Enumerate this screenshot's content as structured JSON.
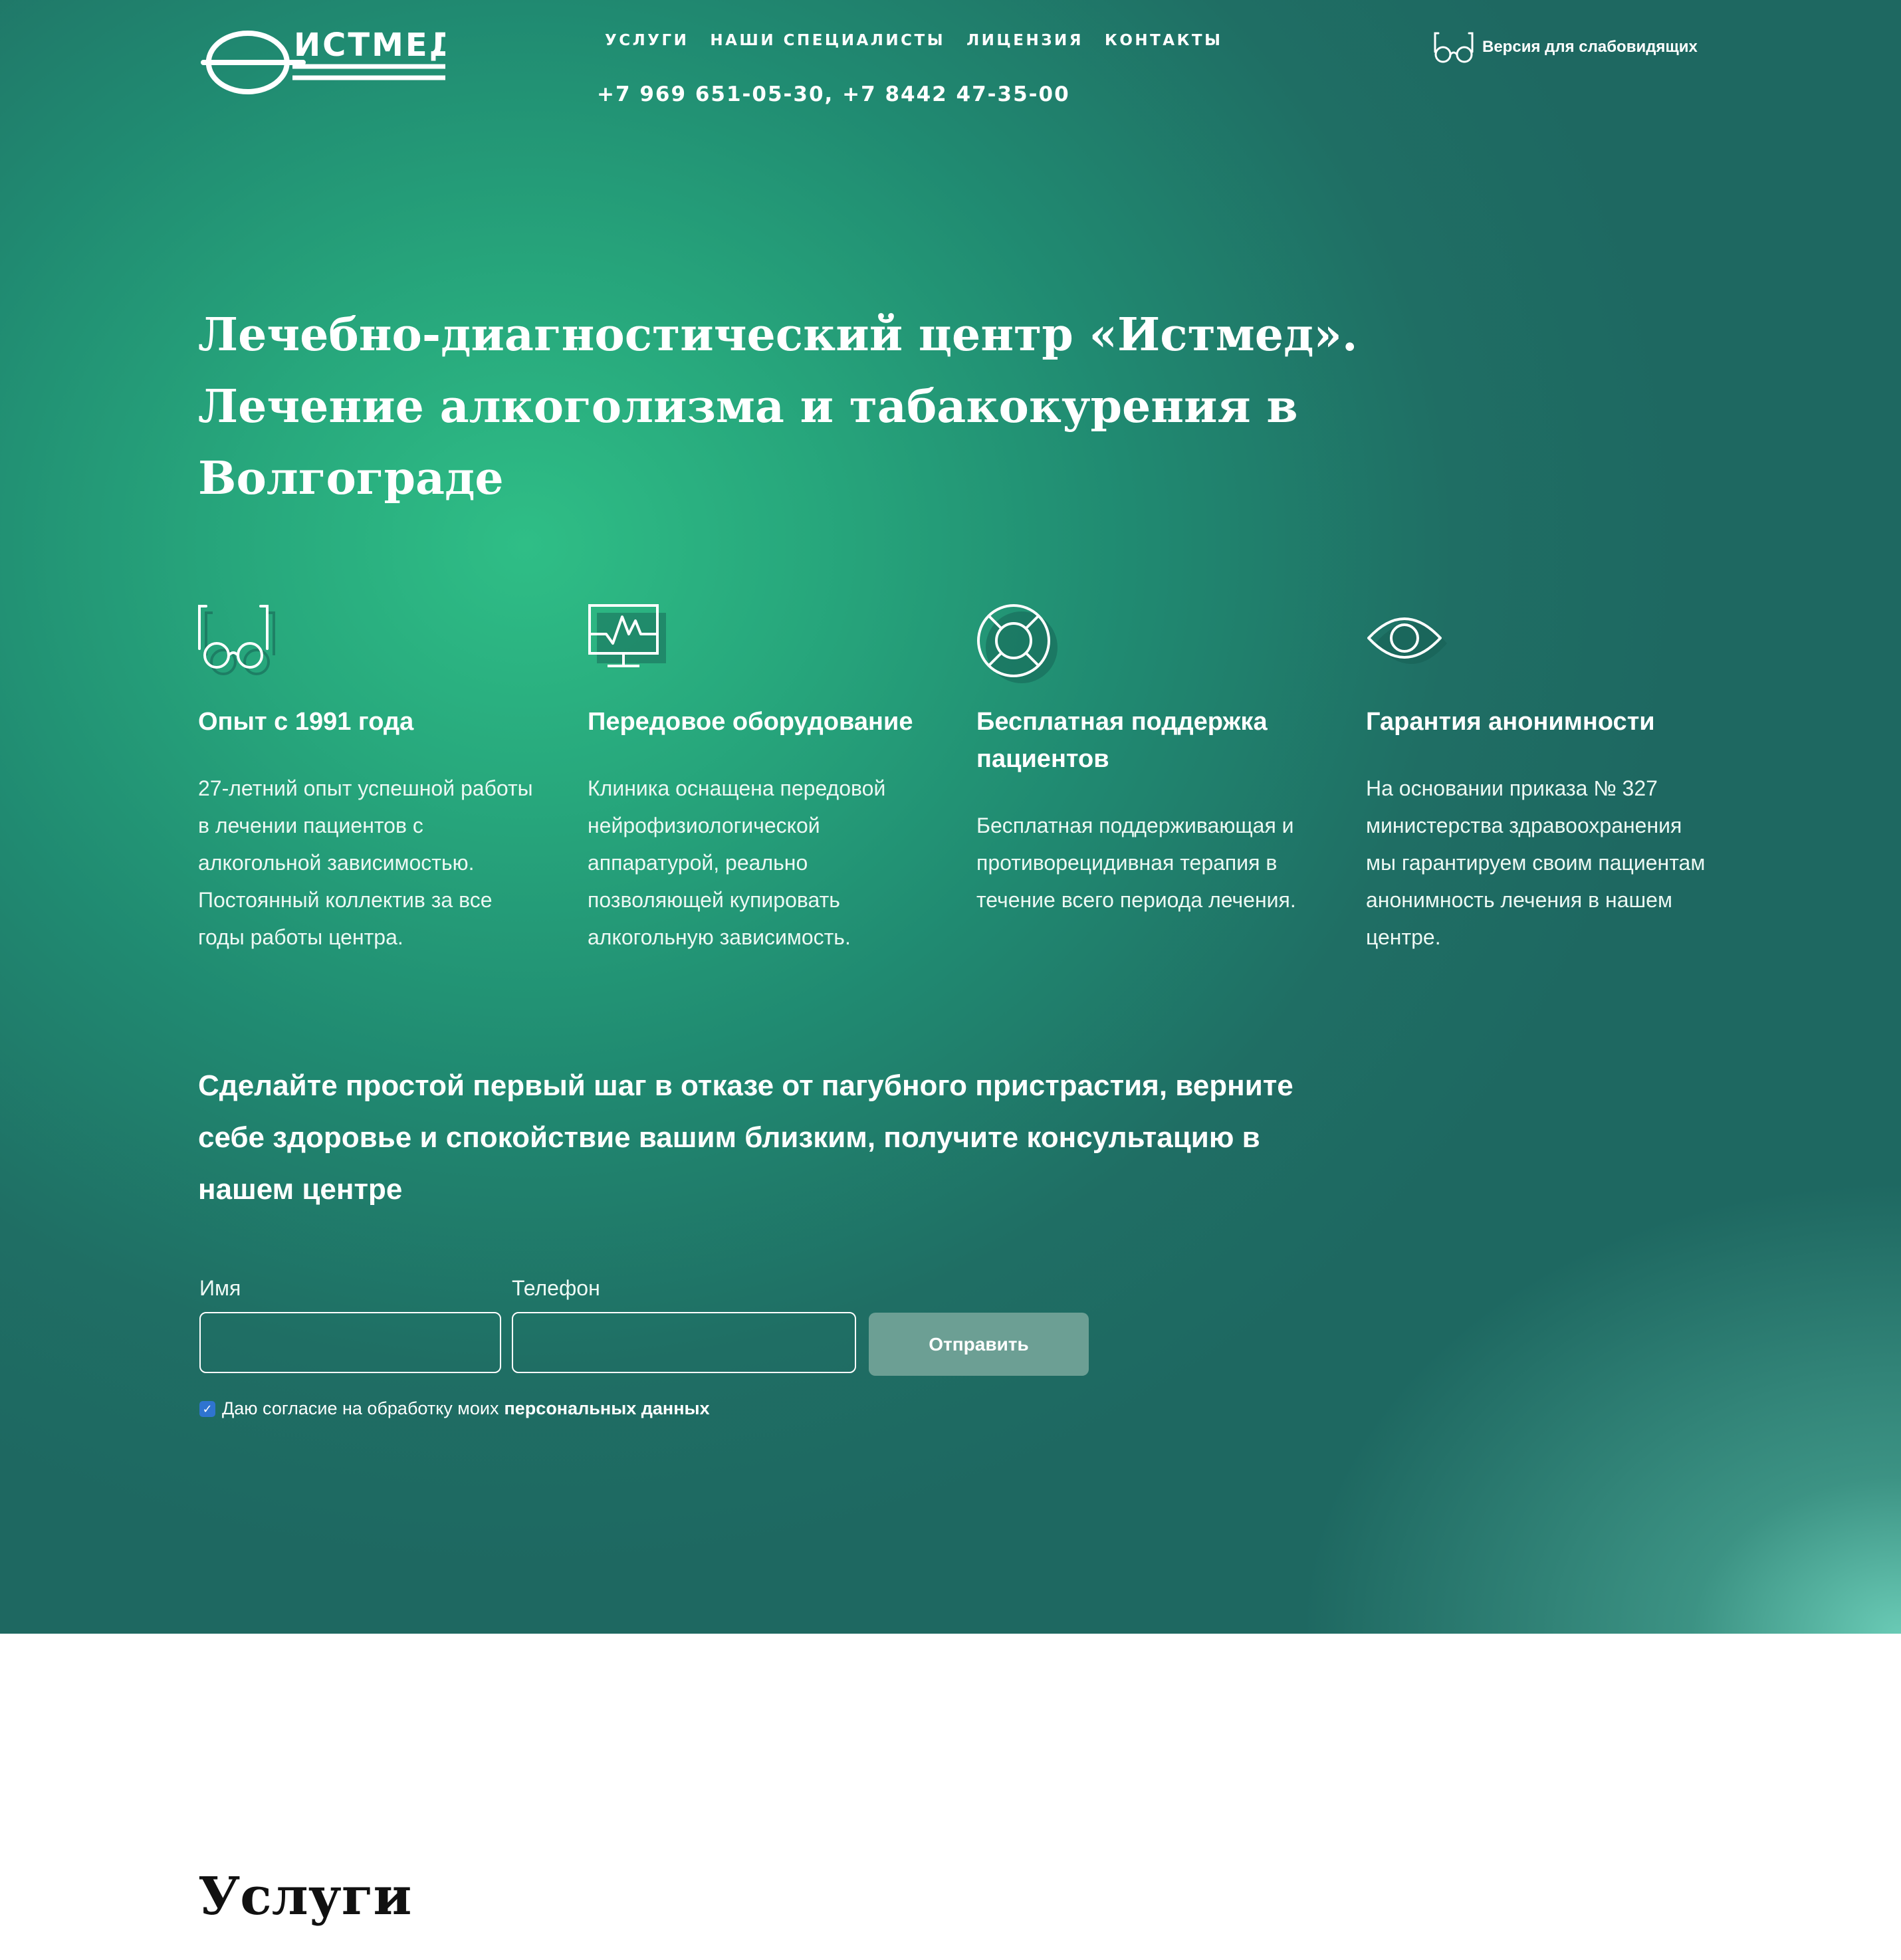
{
  "header": {
    "logo_text": "ИСТМЕД",
    "nav": [
      "УСЛУГИ",
      "НАШИ СПЕЦИАЛИСТЫ",
      "ЛИЦЕНЗИЯ",
      "КОНТАКТЫ"
    ],
    "phones": "+7 969 651-05-30, +7 8442 47-35-00",
    "accessibility_label": "Версия для слабовидящих",
    "accessibility_icon": "glasses-icon"
  },
  "hero": {
    "headline": "Лечебно-диагностический центр «Истмед». Лечение алкоголизма и табакокурения в Волгограде",
    "features": [
      {
        "icon": "glasses-icon",
        "title": "Опыт с 1991 года",
        "text": "27-летний опыт успешной работы в лечении пациентов с алкогольной зависимостью. Постоянный коллектив за все годы работы центра."
      },
      {
        "icon": "monitor-pulse-icon",
        "title": "Передовое оборудование",
        "text": "Клиника оснащена передовой нейрофизиологической аппаратурой, реально позволяющей купировать алкогольную зависимость."
      },
      {
        "icon": "lifebuoy-icon",
        "title": "Бесплатная поддержка пациентов",
        "text": "Бесплатная поддерживающая и противорецидивная терапия в течение всего периода лечения."
      },
      {
        "icon": "eye-icon",
        "title": "Гарантия анонимности",
        "text": "На основании приказа № 327 министерства здравоохранения мы гарантируем своим пациентам анонимность лечения в нашем центре."
      }
    ],
    "cta": "Сделайте простой первый шаг в отказе от пагубного пристрастия, верните себе здоровье и спокойствие вашим близким, получите консультацию в нашем центре"
  },
  "form": {
    "name_label": "Имя",
    "name_value": "",
    "phone_label": "Телефон",
    "phone_value": "",
    "submit_label": "Отправить",
    "consent_checked": true,
    "consent_text": "Даю согласие на обработку моих",
    "consent_link": "персональных данных"
  },
  "services": {
    "title": "Услуги"
  },
  "colors": {
    "hero_dark": "#1e6861",
    "hero_light": "#2fbe86",
    "accent_corner": "#6ed0ba",
    "button_bg": "#6c9f94",
    "checkbox": "#2f74d0"
  }
}
